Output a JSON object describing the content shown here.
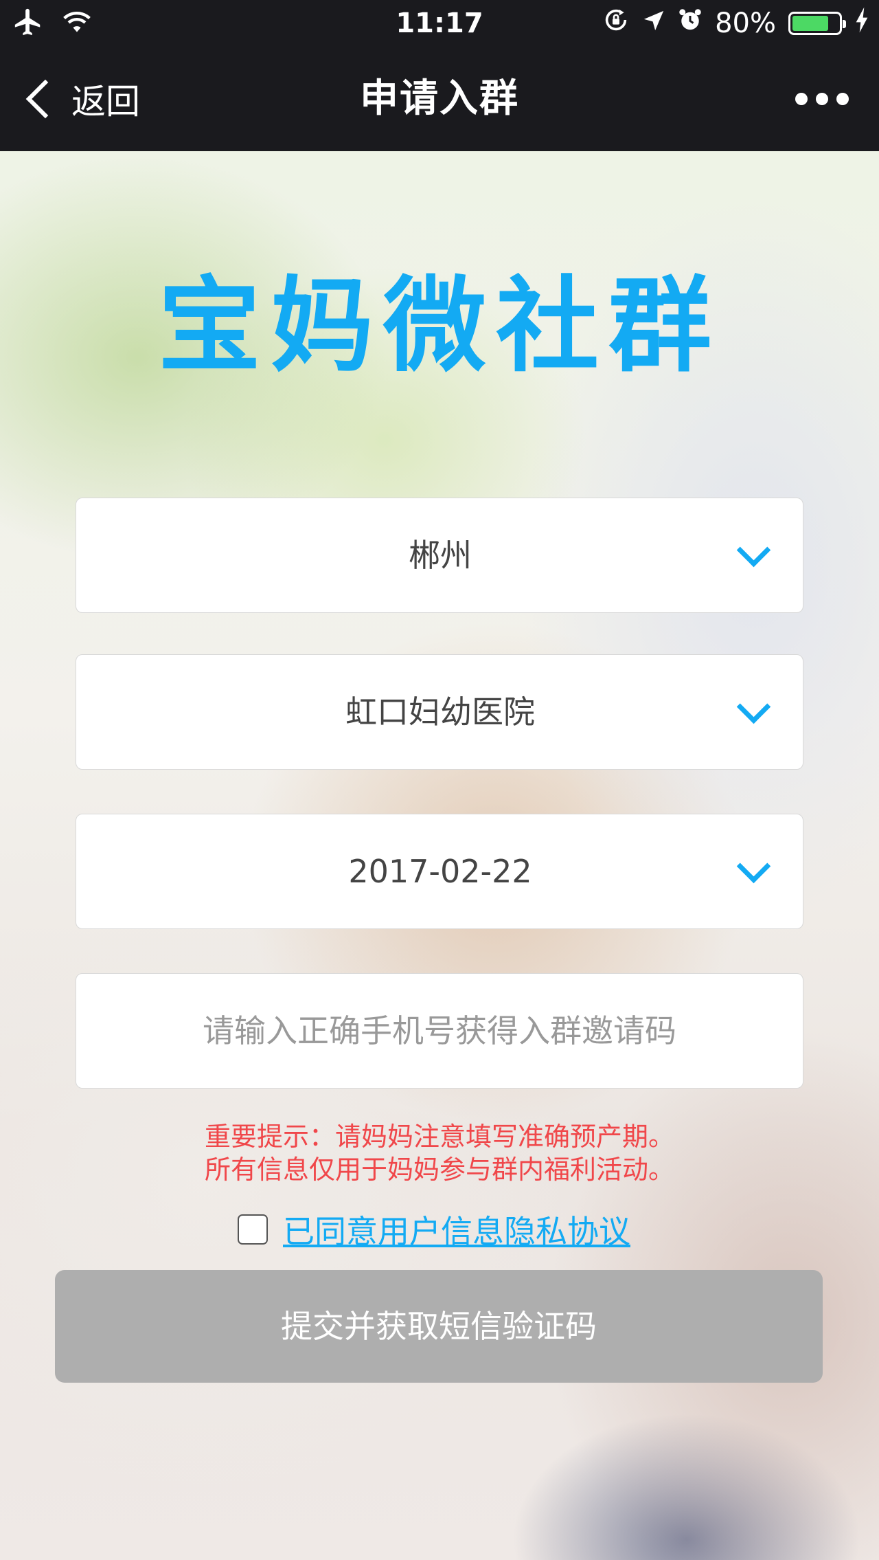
{
  "status_bar": {
    "time": "11:17",
    "battery_text": "80%",
    "battery_level": 0.8,
    "icons": [
      "airplane-icon",
      "wifi-icon",
      "orientation-lock-icon",
      "location-icon",
      "alarm-icon",
      "battery-icon",
      "charging-icon"
    ]
  },
  "nav": {
    "back_label": "返回",
    "title": "申请入群"
  },
  "brand": {
    "title": "宝妈微社群",
    "color": "#13aaf3"
  },
  "form": {
    "city": "郴州",
    "hospital": "虹口妇幼医院",
    "due_date": "2017-02-22",
    "phone_placeholder": "请输入正确手机号获得入群邀请码"
  },
  "notice": {
    "line1": "重要提示：请妈妈注意填写准确预产期。",
    "line2": "所有信息仅用于妈妈参与群内福利活动。",
    "color": "#f0474a"
  },
  "agreement": {
    "checked": false,
    "link_text": "已同意用户信息隐私协议"
  },
  "submit": {
    "label": "提交并获取短信验证码"
  }
}
